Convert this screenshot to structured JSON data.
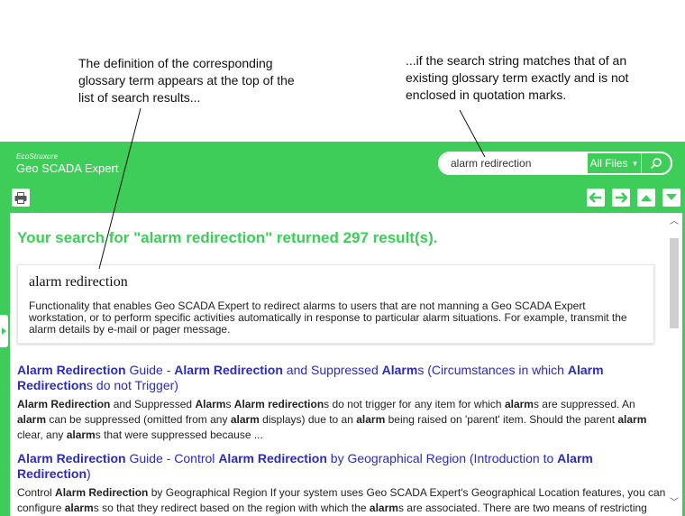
{
  "callouts": {
    "left": "The definition of the corresponding glossary term appears at the top of the list of search results...",
    "right": "...if the search string matches that of an existing glossary term exactly and is not enclosed in quotation marks."
  },
  "brand": {
    "top_line": "EcoStruxure",
    "name": "Geo SCADA Expert"
  },
  "search": {
    "value": "alarm redirection",
    "files_label": "All Files"
  },
  "results": {
    "heading": "Your search for \"alarm redirection\" returned 297 result(s)."
  },
  "glossary": {
    "term": "alarm redirection",
    "definition": "Functionality that enables Geo SCADA Expert to redirect alarms to users that are not manning a Geo SCADA Expert workstation, or to perform specific activities automatically in response to particular alarm situations. For example, transmit the alarm details by e-mail or pager message."
  },
  "result_items": [
    {
      "title_segments": [
        {
          "t": "Alarm Redirection",
          "b": true
        },
        {
          "t": " Guide - ",
          "b": false
        },
        {
          "t": "Alarm Redirection",
          "b": true
        },
        {
          "t": " and Suppressed ",
          "b": false
        },
        {
          "t": "Alarm",
          "b": true
        },
        {
          "t": "s (Circumstances in which ",
          "b": false
        },
        {
          "t": "Alarm Redirection",
          "b": true
        },
        {
          "t": "s do not Trigger)",
          "b": false
        }
      ],
      "snippet_segments": [
        {
          "t": "Alarm Redirection",
          "b": true
        },
        {
          "t": " and Suppressed ",
          "b": false
        },
        {
          "t": "Alarm",
          "b": true
        },
        {
          "t": "s ",
          "b": false
        },
        {
          "t": "Alarm redirection",
          "b": true
        },
        {
          "t": "s do not trigger for any item for which ",
          "b": false
        },
        {
          "t": "alarm",
          "b": true
        },
        {
          "t": "s are suppressed. An ",
          "b": false
        },
        {
          "t": "alarm",
          "b": true
        },
        {
          "t": " can be suppressed (omitted from any ",
          "b": false
        },
        {
          "t": "alarm",
          "b": true
        },
        {
          "t": " displays) due to an ",
          "b": false
        },
        {
          "t": "alarm",
          "b": true
        },
        {
          "t": " being raised on 'parent' item. Should the parent ",
          "b": false
        },
        {
          "t": "alarm",
          "b": true
        },
        {
          "t": " clear, any ",
          "b": false
        },
        {
          "t": "alarm",
          "b": true
        },
        {
          "t": "s that were suppressed because ...",
          "b": false
        }
      ]
    },
    {
      "title_segments": [
        {
          "t": "Alarm Redirection",
          "b": true
        },
        {
          "t": " Guide - Control ",
          "b": false
        },
        {
          "t": "Alarm Redirection",
          "b": true
        },
        {
          "t": " by Geographical Region (Introduction to ",
          "b": false
        },
        {
          "t": "Alarm Redirection",
          "b": true
        },
        {
          "t": ")",
          "b": false
        }
      ],
      "snippet_segments": [
        {
          "t": "Control ",
          "b": false
        },
        {
          "t": "Alarm Redirection",
          "b": true
        },
        {
          "t": " by Geographical Region If your system uses Geo SCADA Expert's Geographical Location features, you can configure ",
          "b": false
        },
        {
          "t": "alarm",
          "b": true
        },
        {
          "t": "s so that they redirect based on the region with which the ",
          "b": false
        },
        {
          "t": "alarm",
          "b": true
        },
        {
          "t": "s are associated. There are two means of restricting ",
          "b": false
        },
        {
          "t": "alarm redirection",
          "b": true
        },
        {
          "t": " based on region. ...",
          "b": false
        }
      ]
    }
  ],
  "icons": {
    "print": "printer-icon",
    "prev": "arrow-left-icon",
    "next": "arrow-right-icon",
    "up": "arrow-up-icon",
    "down": "arrow-down-icon",
    "search": "magnifier-icon"
  },
  "colors": {
    "brand_green": "#3dcd58",
    "link_blue": "#2b2bbf"
  }
}
